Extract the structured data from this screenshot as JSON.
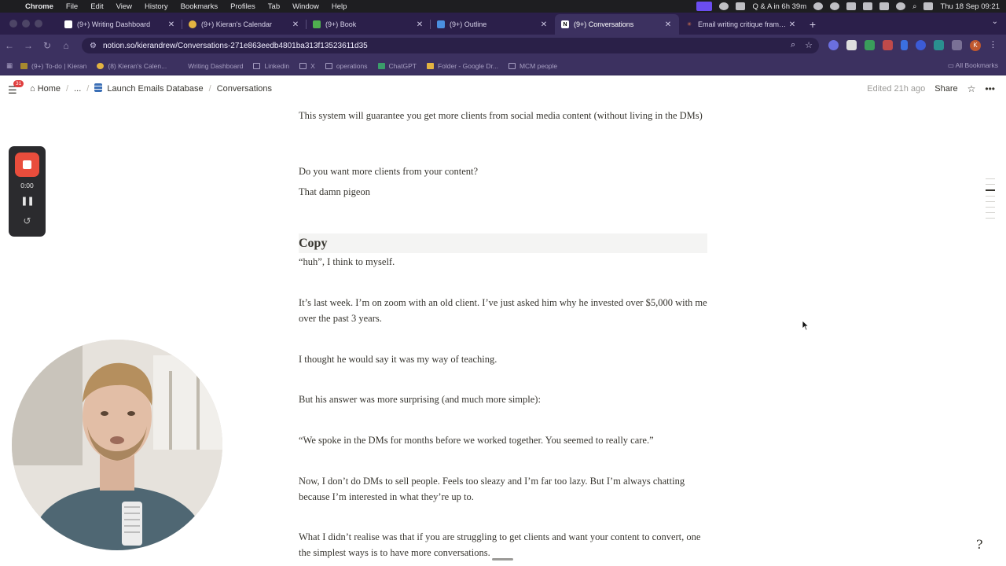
{
  "menubar": {
    "items": [
      "Chrome",
      "File",
      "Edit",
      "View",
      "History",
      "Bookmarks",
      "Profiles",
      "Tab",
      "Window",
      "Help"
    ],
    "countdown": "Q & A in 6h 39m",
    "datetime": "Thu 18 Sep  09:21"
  },
  "tabs": [
    {
      "title": "(9+) Writing Dashboard",
      "icon": "notion-icon",
      "active": false
    },
    {
      "title": "(9+) Kieran's Calendar",
      "icon": "calendar-icon",
      "active": false
    },
    {
      "title": "(9+) Book",
      "icon": "book-icon",
      "active": false
    },
    {
      "title": "(9+) Outline",
      "icon": "outline-icon",
      "active": false
    },
    {
      "title": "(9+) Conversations",
      "icon": "notion-icon",
      "active": true
    },
    {
      "title": "Email writing critique framew…",
      "icon": "claude-icon",
      "active": false
    }
  ],
  "address": {
    "url": "notion.so/kierandrew/Conversations-271e863eedb4801ba313f13523611d35"
  },
  "bookmarks": {
    "items": [
      {
        "label": "(9+) To-do | Kieran",
        "icon": "bookmark-icon"
      },
      {
        "label": "(8) Kieran's Calen...",
        "icon": "calendar-icon"
      },
      {
        "label": "Writing Dashboard",
        "icon": "notion-icon"
      },
      {
        "label": "Linkedin",
        "icon": "folder-icon"
      },
      {
        "label": "X",
        "icon": "folder-icon"
      },
      {
        "label": "operations",
        "icon": "folder-icon"
      },
      {
        "label": "ChatGPT",
        "icon": "chatgpt-icon"
      },
      {
        "label": "Folder - Google Dr...",
        "icon": "drive-icon"
      },
      {
        "label": "MCM people",
        "icon": "folder-icon"
      }
    ],
    "all_label": "All Bookmarks"
  },
  "notion": {
    "badge": "31",
    "breadcrumbs": [
      "Home",
      "...",
      "Launch Emails Database",
      "Conversations"
    ],
    "edited": "Edited 21h ago",
    "share": "Share"
  },
  "content": {
    "paragraphs_top": [
      "This system will guarantee you get more clients from social media content (without living in the DMs)",
      "Do you want more clients from your content?",
      "That damn pigeon"
    ],
    "heading": "Copy",
    "paragraphs": [
      "“huh”, I think to myself.",
      "It’s last week. I’m on zoom with an old client. I’ve just asked him why he invested over $5,000 with me over the past 3 years.",
      "I thought he would say it was my way of teaching.",
      "But his answer was more surprising (and much more simple):",
      "“We spoke in the DMs for months before we worked together. You seemed to really care.”",
      "Now, I don’t do DMs to sell people. Feels too sleazy and I’m far too lazy. But I’m always chatting because I’m interested in what they’re up to.",
      "What I didn’t realise was that if you are struggling to get clients and want your content to convert, one the simplest ways is to have more conversations."
    ]
  },
  "recorder": {
    "timer": "0:00"
  }
}
